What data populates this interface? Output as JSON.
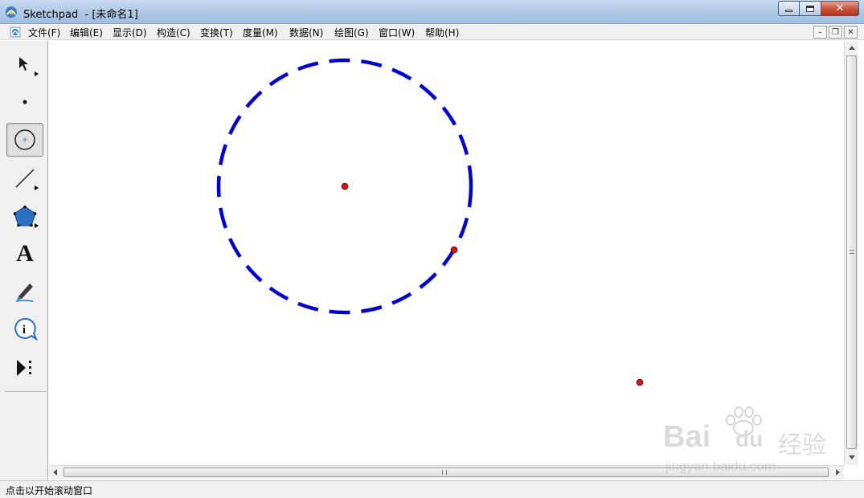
{
  "window": {
    "title": "Sketchpad  - [未命名1]",
    "controls": {
      "minimize": "─",
      "maximize": "☐",
      "close": "✕"
    }
  },
  "menu": {
    "items": [
      {
        "label": "文件(F)"
      },
      {
        "label": "编辑(E)"
      },
      {
        "label": "显示(D)"
      },
      {
        "label": "构造(C)"
      },
      {
        "label": "变换(T)"
      },
      {
        "label": "度量(M)"
      },
      {
        "label": "数据(N)"
      },
      {
        "label": "绘图(G)"
      },
      {
        "label": "窗口(W)"
      },
      {
        "label": "帮助(H)"
      }
    ],
    "mdi_controls": {
      "minimize": "–",
      "restore": "❐",
      "close": "✕"
    }
  },
  "toolbox": {
    "tools": [
      {
        "name": "arrow-tool",
        "icon": "arrow-icon",
        "active": false
      },
      {
        "name": "point-tool",
        "icon": "point-icon",
        "active": false
      },
      {
        "name": "compass-tool",
        "icon": "circle-icon",
        "active": true
      },
      {
        "name": "straightedge-tool",
        "icon": "line-icon",
        "active": false
      },
      {
        "name": "polygon-tool",
        "icon": "polygon-icon",
        "active": false
      },
      {
        "name": "text-tool",
        "icon": "text-icon",
        "label": "A",
        "active": false
      },
      {
        "name": "marker-tool",
        "icon": "marker-icon",
        "active": false
      },
      {
        "name": "information-tool",
        "icon": "info-icon",
        "label": "i",
        "active": false
      },
      {
        "name": "custom-tool",
        "icon": "custom-tools-icon",
        "active": false
      }
    ]
  },
  "canvas": {
    "circle_color": "#0000cc",
    "point_color": "#cc0000"
  },
  "status": {
    "text": "点击以开始滚动窗口"
  },
  "watermark": {
    "brand": "Bai",
    "brand2": "du",
    "brand3": "经验",
    "url": "jingyan.baidu.com"
  }
}
